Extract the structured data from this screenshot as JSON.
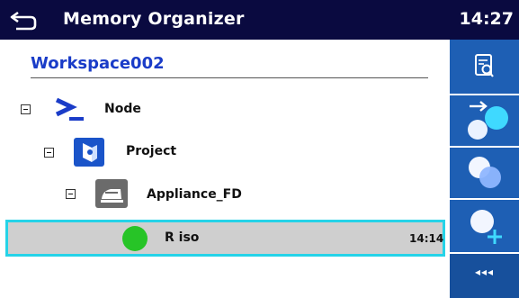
{
  "header": {
    "title": "Memory Organizer",
    "time": "14:27"
  },
  "workspace": {
    "name": "Workspace002"
  },
  "tree": {
    "node": {
      "label": "Node",
      "icon": "node-prompt-icon"
    },
    "project": {
      "label": "Project",
      "icon": "project-icon"
    },
    "appliance": {
      "label": "Appliance_FD",
      "icon": "appliance-iron-icon"
    },
    "measurement": {
      "label": "R iso",
      "time": "14:14",
      "status": "pass",
      "status_color": "#27c427"
    }
  },
  "sidebar": {
    "items": [
      {
        "icon": "view-document-icon"
      },
      {
        "icon": "start-test-icon"
      },
      {
        "icon": "clone-test-icon"
      },
      {
        "icon": "add-test-icon"
      },
      {
        "icon": "more-icon",
        "label": "◂◂◂"
      }
    ]
  },
  "colors": {
    "header_bg": "#0a0a40",
    "sidebar_bg": "#1e5fb4",
    "selection_border": "#25d3e8",
    "workspace_text": "#1a3cc8"
  }
}
